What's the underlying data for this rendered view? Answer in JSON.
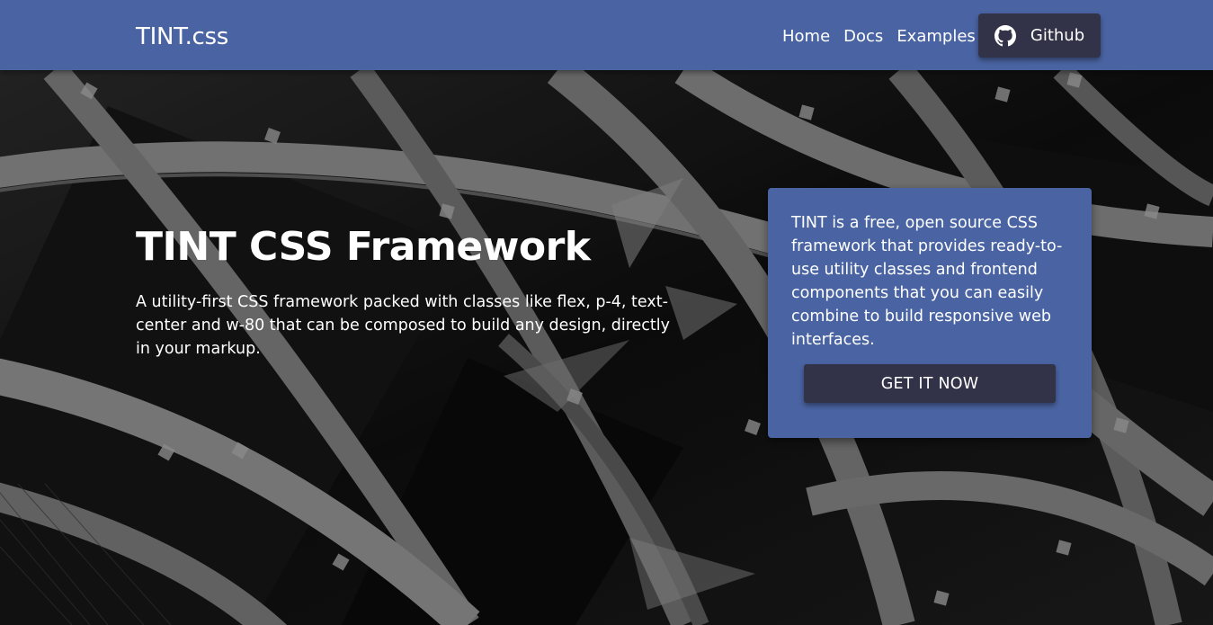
{
  "navbar": {
    "brand": "TINT.css",
    "links": [
      {
        "label": "Home"
      },
      {
        "label": "Docs"
      },
      {
        "label": "Examples"
      }
    ],
    "github_label": "Github",
    "github_icon": "github-icon"
  },
  "hero": {
    "title": "TINT CSS Framework",
    "subtitle": "A utility-first CSS framework packed with classes like flex, p-4, text-center and w-80 that can be composed to build any design, directly in your markup."
  },
  "card": {
    "text": "TINT is a free, open source CSS framework that provides ready-to-use utility classes and frontend components that you can easily combine to build responsive web interfaces.",
    "cta_label": "GET IT NOW"
  },
  "colors": {
    "primary": "#4a64a3",
    "button_dark": "#323248"
  }
}
